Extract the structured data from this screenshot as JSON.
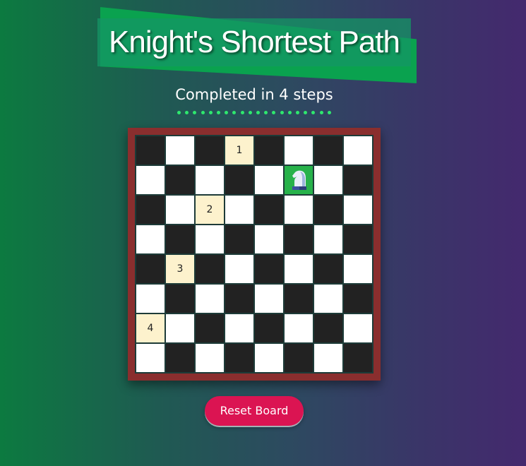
{
  "title": "Knight's Shortest Path",
  "status": "Completed in 4 steps",
  "board": {
    "rows": 8,
    "cols": 8,
    "knight": {
      "row": 1,
      "col": 5,
      "icon": "knight-icon"
    },
    "path_steps": [
      {
        "row": 0,
        "col": 3,
        "label": "1"
      },
      {
        "row": 2,
        "col": 2,
        "label": "2"
      },
      {
        "row": 4,
        "col": 1,
        "label": "3"
      },
      {
        "row": 6,
        "col": 0,
        "label": "4"
      }
    ]
  },
  "reset_button": "Reset Board",
  "colors": {
    "light_square": "#ffffff",
    "dark_square": "#222222",
    "path_square": "#fdf2cd",
    "knight_square": "#27b24a",
    "board_frame": "#8a2e2e",
    "button": "#db1452",
    "dots": "#2ee86e"
  }
}
